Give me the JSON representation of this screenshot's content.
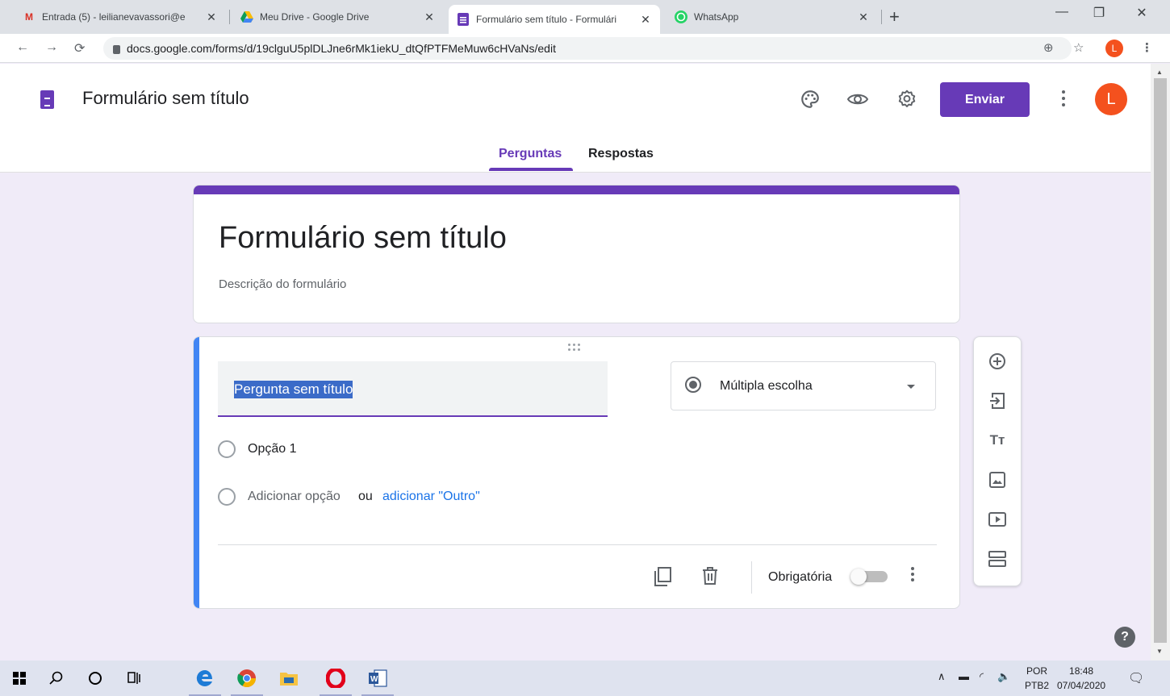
{
  "browser": {
    "tabs": [
      {
        "title": "Entrada (5) - leilianevavassori@e",
        "favicon": "gmail-icon"
      },
      {
        "title": "Meu Drive - Google Drive",
        "favicon": "drive-icon"
      },
      {
        "title": "Formulário sem título - Formulári",
        "favicon": "forms-icon",
        "active": true
      },
      {
        "title": "WhatsApp",
        "favicon": "whatsapp-icon"
      }
    ],
    "url": "docs.google.com/forms/d/19clguU5plDLJne6rMk1iekU_dtQfPTFMeMuw6cHVaNs/edit",
    "profile_initial": "L"
  },
  "header": {
    "title": "Formulário sem título",
    "send_label": "Enviar",
    "avatar_initial": "L",
    "tabs": {
      "questions": "Perguntas",
      "responses": "Respostas"
    }
  },
  "form": {
    "title": "Formulário sem título",
    "description": "Descrição do formulário"
  },
  "question": {
    "title": "Pergunta sem título",
    "type": "Múltipla escolha",
    "options": [
      "Opção 1"
    ],
    "add_option": "Adicionar opção",
    "or": "ou",
    "add_other": "adicionar \"Outro\"",
    "required_label": "Obrigatória",
    "required": false
  },
  "taskbar": {
    "lang_top": "POR",
    "lang_bottom": "PTB2",
    "time": "18:48",
    "date": "07/04/2020"
  },
  "colors": {
    "accent": "#673ab7",
    "focus": "#4285f4",
    "link": "#1a73e8",
    "background": "#f0ebf8"
  }
}
